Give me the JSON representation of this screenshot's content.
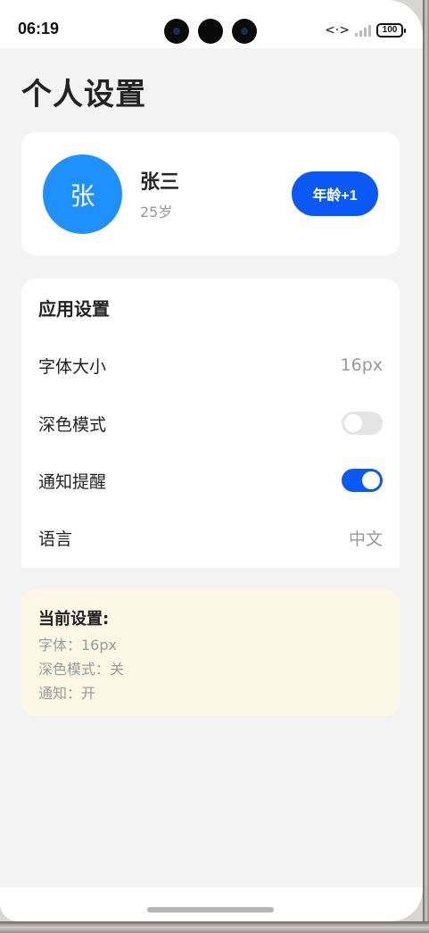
{
  "status_bar": {
    "time": "06:19",
    "network_icon": "<·>",
    "battery": "100"
  },
  "page": {
    "title": "个人设置"
  },
  "profile": {
    "avatar_text": "张",
    "name": "张三",
    "age": "25岁",
    "age_button_label": "年龄+1"
  },
  "app_settings": {
    "title": "应用设置",
    "font_size": {
      "label": "字体大小",
      "value": "16px"
    },
    "dark_mode": {
      "label": "深色模式",
      "enabled": false
    },
    "notifications": {
      "label": "通知提醒",
      "enabled": true
    },
    "language": {
      "label": "语言",
      "value": "中文"
    }
  },
  "summary": {
    "title": "当前设置:",
    "lines": [
      "字体：16px",
      "深色模式：关",
      "通知：开"
    ]
  },
  "colors": {
    "primary": "#0a59f7",
    "avatar": "#1e90ff",
    "summary_bg": "#fdf8e6",
    "page_bg": "#f3f3f3"
  }
}
